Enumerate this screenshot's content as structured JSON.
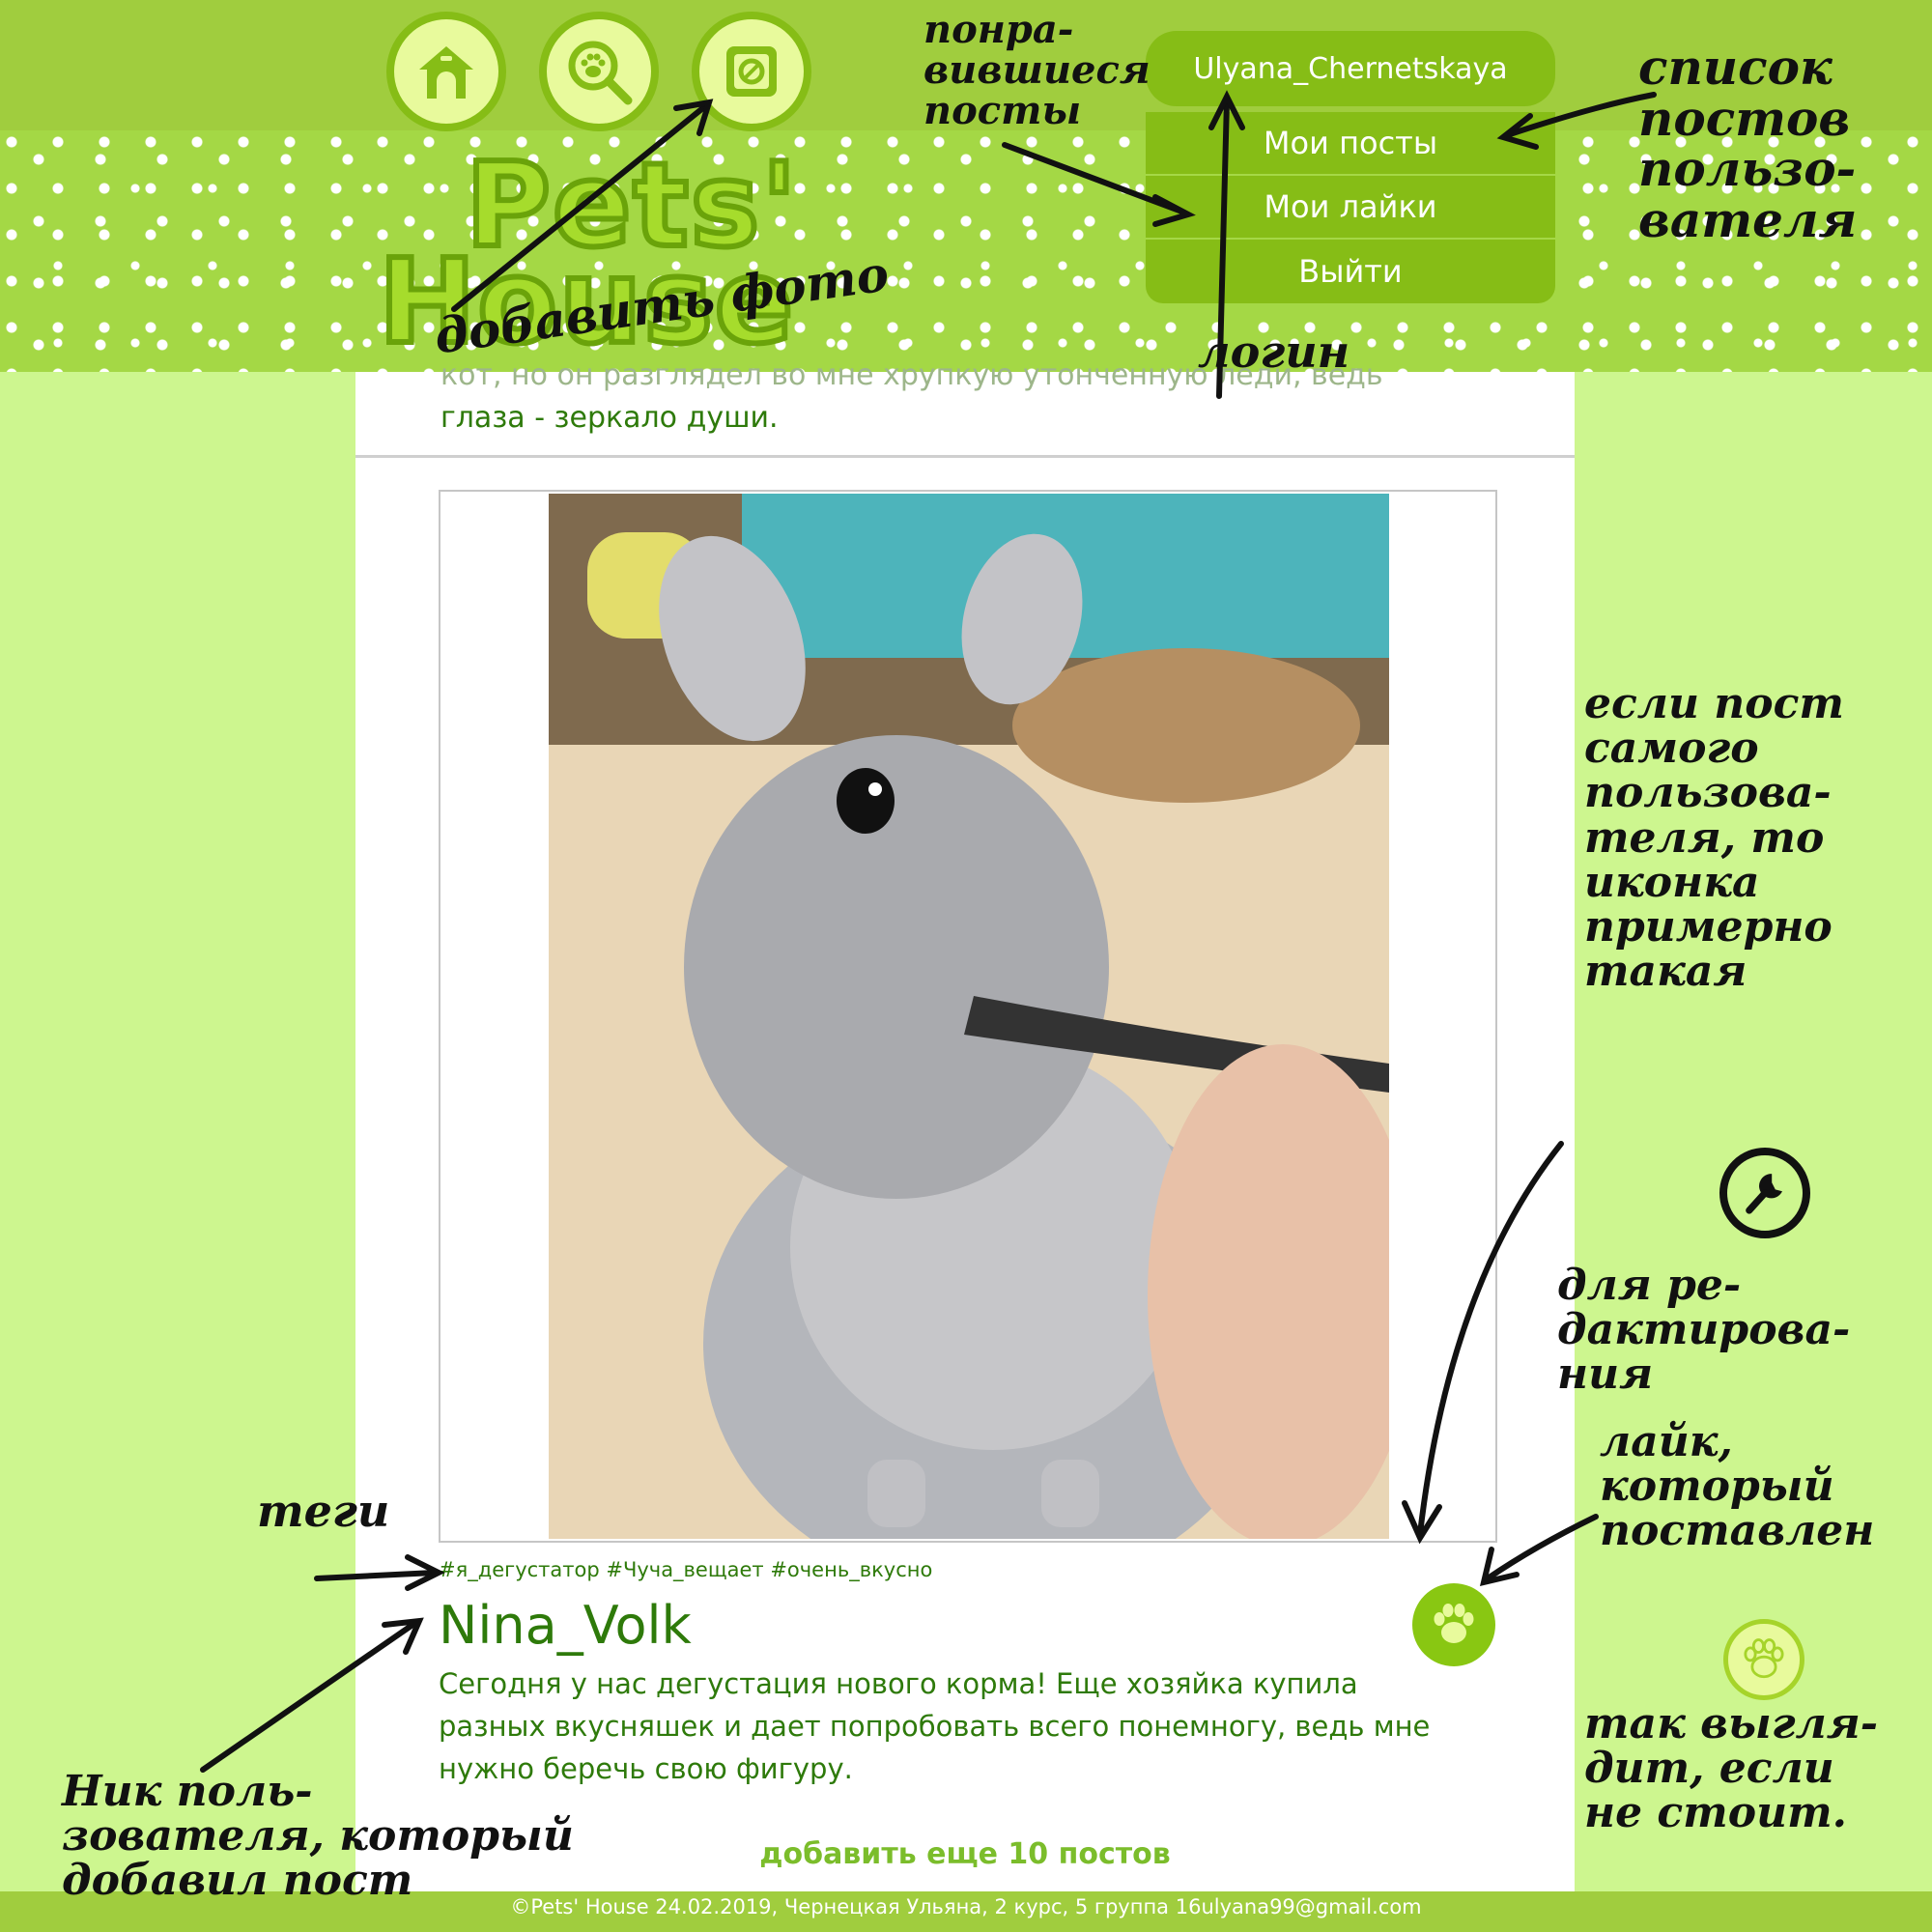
{
  "header": {
    "nav_icons": [
      "home-icon",
      "search-paw-icon",
      "add-photo-icon"
    ],
    "user": {
      "login": "Ulyana_Chernetskaya",
      "menu": [
        "Мои посты",
        "Мои лайки",
        "Выйти"
      ]
    },
    "logo": {
      "line1": "Pets'",
      "line2": "House"
    }
  },
  "feed": {
    "previous_post_text_cut": "кот, но он разглядел во мне хрупкую утонченную леди, ведь",
    "previous_post_text_end": "глаза - зеркало души.",
    "post": {
      "image": "chinchilla-eating-photo",
      "tags": "#я_дегустатор #Чуча_вещает #очень_вкусно",
      "author": "Nina_Volk",
      "text": "Сегодня у нас дегустация нового корма! Еще хозяйка купила разных вкусняшек и дает попробовать всего понемногу, ведь мне нужно беречь свою фигуру.",
      "like_icon": "paw-icon"
    },
    "load_more": "добавить еще 10 постов"
  },
  "footer": {
    "text": "©Pets' House 24.02.2019, Чернецкая Ульяна, 2 курс, 5 группа 16ulyana99@gmail.com"
  },
  "annotations": {
    "liked_posts": "понра-\nвившиеся\nпосты",
    "add_photo": "добавить фото",
    "login": "логин",
    "user_posts": "список\nпостов\nпользо-\nвателя",
    "own_post_note": "если пост\nсамого\nпользова-\nтеля, то\nиконка\nпримерно\nтакая",
    "edit_note": "для ре-\nдактирова-\nния",
    "like_note": "лайк,\nкоторый\nпоставлен",
    "unliked_note": "так выгля-\nдит, если\nне стоит.",
    "tags_note": "теги",
    "nick_note": "Ник поль-\nзователя, который\nдобавил пост"
  },
  "colors": {
    "header_dark": "#a0cd3e",
    "accent": "#86bd16",
    "text_green": "#2e7a0a",
    "page_bg": "#cdf68f"
  }
}
